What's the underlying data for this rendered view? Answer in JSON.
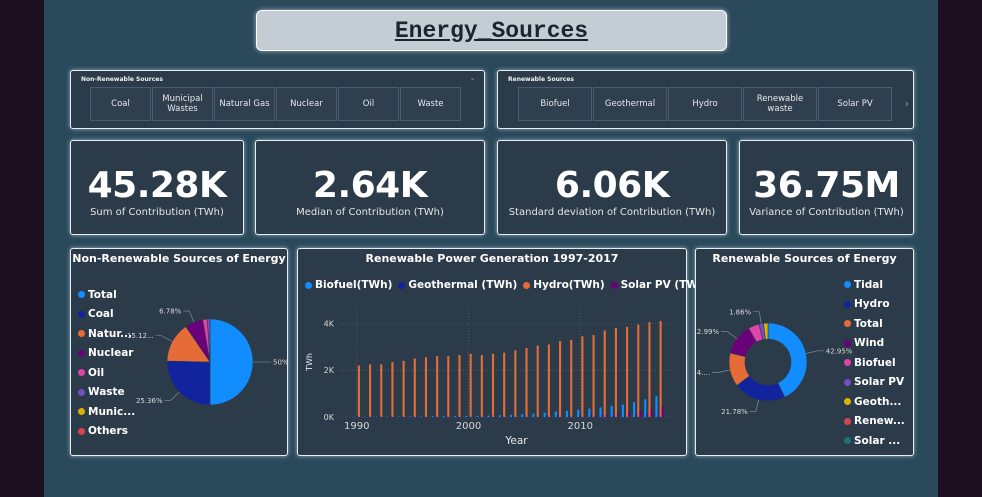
{
  "title": "Energy_Sources",
  "slicers": {
    "non_renewable": {
      "title": "Non-Renewable Sources",
      "items": [
        "Coal",
        "Municipal Wastes",
        "Natural Gas",
        "Nuclear",
        "Oil",
        "Waste"
      ]
    },
    "renewable": {
      "title": "Renewable Sources",
      "items": [
        "Biofuel",
        "Geothermal",
        "Hydro",
        "Renewable waste",
        "Solar PV"
      ]
    }
  },
  "kpis": [
    {
      "value": "45.28K",
      "label": "Sum of Contribution (TWh)"
    },
    {
      "value": "2.64K",
      "label": "Median of Contribution (TWh)"
    },
    {
      "value": "6.06K",
      "label": "Standard deviation of Contribution (TWh)"
    },
    {
      "value": "36.75M",
      "label": "Variance of Contribution (TWh)"
    }
  ],
  "colors": {
    "blue": "#118dff",
    "navy": "#12239e",
    "orange": "#e66c37",
    "purple": "#6b007b",
    "pink": "#e044a7",
    "violet": "#744ec2",
    "yellow": "#d9b300",
    "red": "#d64550",
    "teal": "#197278"
  },
  "chart_data": [
    {
      "type": "pie",
      "title": "Non-Renewable Sources of Energy",
      "legend": [
        "Total",
        "Coal",
        "Natur...",
        "Nuclear",
        "Oil",
        "Waste",
        "Munic...",
        "Others"
      ],
      "legend_colors": [
        "#118dff",
        "#12239e",
        "#e66c37",
        "#6b007b",
        "#e044a7",
        "#744ec2",
        "#d9b300",
        "#d64550"
      ],
      "slices": [
        {
          "label": "Total",
          "value": 50,
          "text": "50%"
        },
        {
          "label": "Coal",
          "value": 25.36,
          "text": "25.36%"
        },
        {
          "label": "Natur...",
          "value": 15.12,
          "text": "15.12..."
        },
        {
          "label": "Nuclear",
          "value": 6.78,
          "text": "6.78%"
        },
        {
          "label": "Oil",
          "value": 1.74,
          "text": ""
        },
        {
          "label": "Waste",
          "value": 1.0,
          "text": ""
        }
      ]
    },
    {
      "type": "bar",
      "title": "Renewable Power Generation 1997-2017",
      "xlabel": "Year",
      "ylabel": "TWh",
      "legend_placement": "top",
      "x_ticks": [
        "1990",
        "2000",
        "2010"
      ],
      "y_ticks": [
        "0K",
        "2K",
        "4K"
      ],
      "ylim": [
        0,
        4700
      ],
      "x": [
        1990,
        1991,
        1992,
        1993,
        1994,
        1995,
        1996,
        1997,
        1998,
        1999,
        2000,
        2001,
        2002,
        2003,
        2004,
        2005,
        2006,
        2007,
        2008,
        2009,
        2010,
        2011,
        2012,
        2013,
        2014,
        2015,
        2016,
        2017
      ],
      "series": [
        {
          "name": "Biofuel(TWh)",
          "color": "#118dff",
          "values": [
            5,
            5,
            10,
            10,
            15,
            20,
            25,
            30,
            35,
            40,
            45,
            50,
            60,
            75,
            90,
            110,
            140,
            180,
            230,
            260,
            310,
            360,
            410,
            470,
            530,
            640,
            760,
            900
          ]
        },
        {
          "name": "Geothermal (TWh)",
          "color": "#12239e",
          "values": [
            35,
            36,
            38,
            40,
            41,
            42,
            43,
            45,
            46,
            48,
            51,
            52,
            53,
            55,
            58,
            59,
            61,
            62,
            64,
            66,
            68,
            69,
            70,
            72,
            75,
            80,
            82,
            85
          ]
        },
        {
          "name": "Hydro(TWh)",
          "color": "#e66c37",
          "values": [
            2200,
            2250,
            2250,
            2350,
            2400,
            2500,
            2550,
            2600,
            2600,
            2650,
            2700,
            2650,
            2700,
            2750,
            2850,
            2950,
            3050,
            3100,
            3250,
            3300,
            3450,
            3500,
            3700,
            3800,
            3850,
            3950,
            4050,
            4100
          ]
        },
        {
          "name": "Solar PV (TWh)",
          "color": "#6b007b",
          "values": [
            1,
            1,
            1,
            1,
            1,
            1,
            1,
            1,
            1,
            1,
            1,
            2,
            2,
            3,
            3,
            4,
            5,
            6,
            12,
            20,
            30,
            60,
            100,
            135,
            200,
            250,
            330,
            450
          ]
        }
      ]
    },
    {
      "type": "pie",
      "title": "Renewable Sources of Energy",
      "legend": [
        "Tidal",
        "Hydro",
        "Total",
        "Wind",
        "Biofuel",
        "Solar PV",
        "Geoth...",
        "Renew...",
        "Solar ..."
      ],
      "legend_colors": [
        "#118dff",
        "#12239e",
        "#e66c37",
        "#6b007b",
        "#e044a7",
        "#744ec2",
        "#d9b300",
        "#d64550",
        "#197278"
      ],
      "slices": [
        {
          "label": "Tidal",
          "value": 42.95,
          "text": "42.95%"
        },
        {
          "label": "Hydro",
          "value": 21.78,
          "text": "21.78%"
        },
        {
          "label": "Total",
          "value": 14.0,
          "text": "14...."
        },
        {
          "label": "Wind",
          "value": 12.99,
          "text": "12.99%"
        },
        {
          "label": "Biofuel",
          "value": 4.6,
          "text": ""
        },
        {
          "label": "Solar PV",
          "value": 1.86,
          "text": "1.86%"
        },
        {
          "label": "Geoth...",
          "value": 1.82,
          "text": ""
        }
      ]
    }
  ]
}
